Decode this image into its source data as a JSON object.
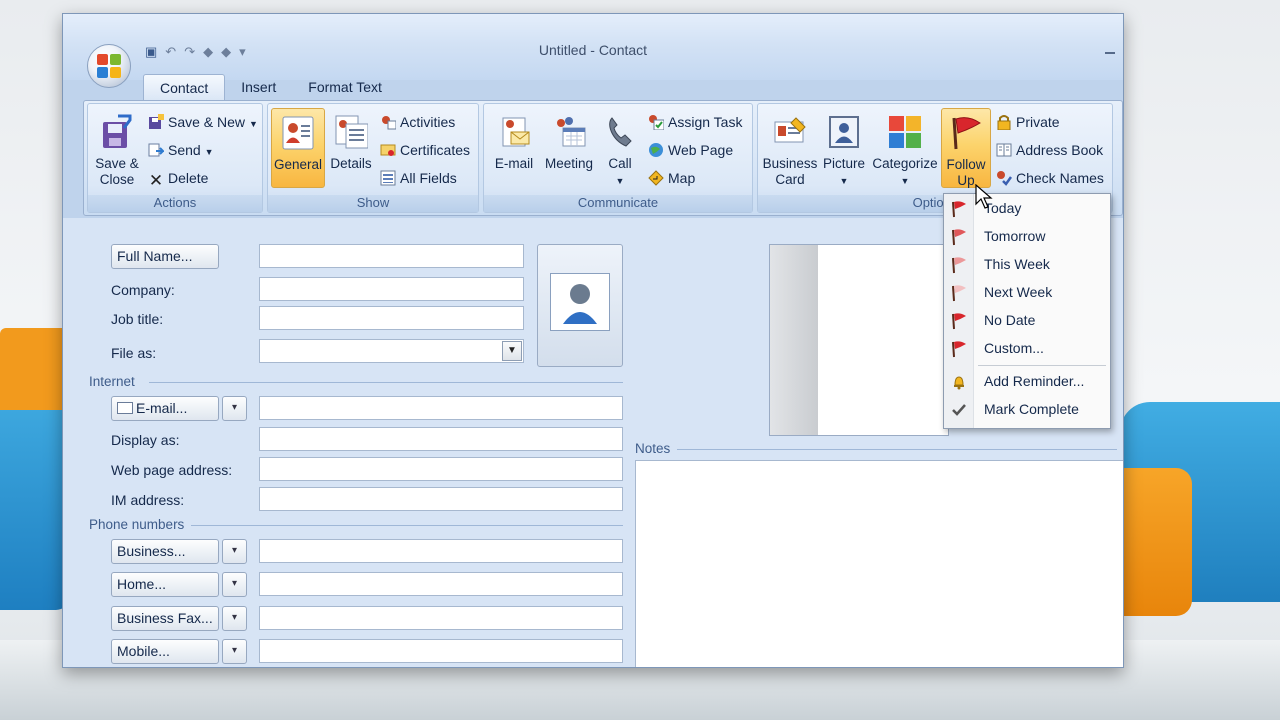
{
  "window": {
    "title": "Untitled - Contact"
  },
  "tabs": [
    "Contact",
    "Insert",
    "Format Text"
  ],
  "ribbon": {
    "actions": {
      "label": "Actions",
      "save_close": "Save & Close",
      "save_new": "Save & New",
      "send": "Send",
      "delete": "Delete"
    },
    "show": {
      "label": "Show",
      "general": "General",
      "details": "Details",
      "activities": "Activities",
      "certificates": "Certificates",
      "all_fields": "All Fields"
    },
    "communicate": {
      "label": "Communicate",
      "email": "E-mail",
      "meeting": "Meeting",
      "call": "Call",
      "assign_task": "Assign Task",
      "web_page": "Web Page",
      "map": "Map"
    },
    "options": {
      "label": "Options",
      "business_card": "Business Card",
      "picture": "Picture",
      "categorize": "Categorize",
      "follow_up": "Follow Up",
      "private": "Private",
      "address_book": "Address Book",
      "check_names": "Check Names"
    }
  },
  "form": {
    "full_name_btn": "Full Name...",
    "company": "Company:",
    "job_title": "Job title:",
    "file_as": "File as:",
    "internet_section": "Internet",
    "email_btn": "E-mail...",
    "display_as": "Display as:",
    "web_page_address": "Web page address:",
    "im_address": "IM address:",
    "phone_section": "Phone numbers",
    "business_btn": "Business...",
    "home_btn": "Home...",
    "business_fax_btn": "Business Fax...",
    "mobile_btn": "Mobile...",
    "notes_label": "Notes"
  },
  "followup_menu": [
    "Today",
    "Tomorrow",
    "This Week",
    "Next Week",
    "No Date",
    "Custom...",
    "Add Reminder...",
    "Mark Complete"
  ],
  "colors": {
    "ribbon_bg": "#d7e5f6",
    "selected_orange": "#fcd46d",
    "flag_red": "#d8262c",
    "form_bg": "#d7e4f5"
  }
}
